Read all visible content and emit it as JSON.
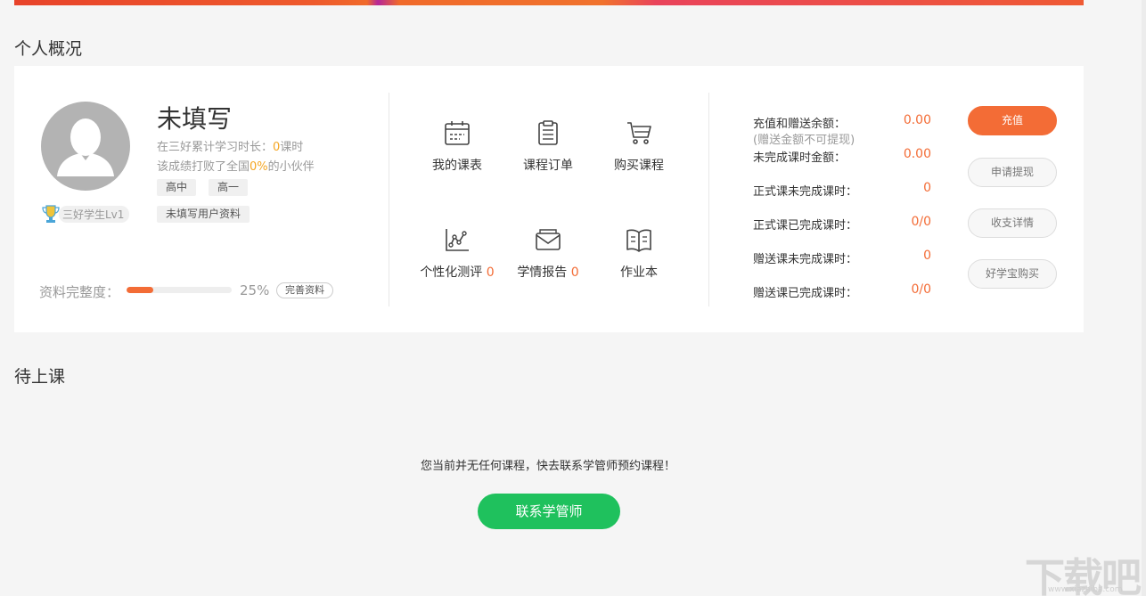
{
  "sections": {
    "overview_title": "个人概况",
    "upcoming_title": "待上课"
  },
  "profile": {
    "name": "未填写",
    "study_prefix": "在三好累计学习时长：",
    "study_hours": "0",
    "study_unit": "课时",
    "beat_prefix": "该成绩打败了全国",
    "beat_percent": "0%",
    "beat_suffix": "的小伙伴",
    "tags": [
      "高中",
      "高一"
    ],
    "profile_tag": "未填写用户资料",
    "level": "三好学生Lv1",
    "completeness_label": "资料完整度：",
    "completeness_pct": "25%",
    "completeness_value": 0.25,
    "complete_button": "完善资料"
  },
  "menu": [
    {
      "label": "我的课表",
      "icon": "calendar-icon",
      "count": ""
    },
    {
      "label": "课程订单",
      "icon": "clipboard-icon",
      "count": ""
    },
    {
      "label": "购买课程",
      "icon": "cart-icon",
      "count": ""
    },
    {
      "label": "个性化测评",
      "icon": "chart-icon",
      "count": "0"
    },
    {
      "label": "学情报告",
      "icon": "envelope-icon",
      "count": "0"
    },
    {
      "label": "作业本",
      "icon": "book-icon",
      "count": ""
    }
  ],
  "account": {
    "rows": [
      {
        "label": "充值和赠送余额：",
        "value": "0.00"
      },
      {
        "label": "未完成课时金额：",
        "value": "0.00"
      },
      {
        "label": "正式课未完成课时：",
        "value": "0"
      },
      {
        "label": "正式课已完成课时：",
        "value": "0/0"
      },
      {
        "label": "赠送课未完成课时：",
        "value": "0"
      },
      {
        "label": "赠送课已完成课时：",
        "value": "0/0"
      }
    ],
    "note": "(赠送金额不可提现)",
    "buttons": [
      "充值",
      "申请提现",
      "收支详情",
      "好学宝购买"
    ]
  },
  "upcoming": {
    "empty_message": "您当前并无任何课程，快去联系学管师预约课程！",
    "contact_button": "联系学管师"
  },
  "watermark": {
    "text": "下载吧",
    "sub": "www.xiazaiba.com"
  },
  "colors": {
    "accent": "#f36c36",
    "green": "#1fc15d",
    "highlight": "#f5a623"
  }
}
